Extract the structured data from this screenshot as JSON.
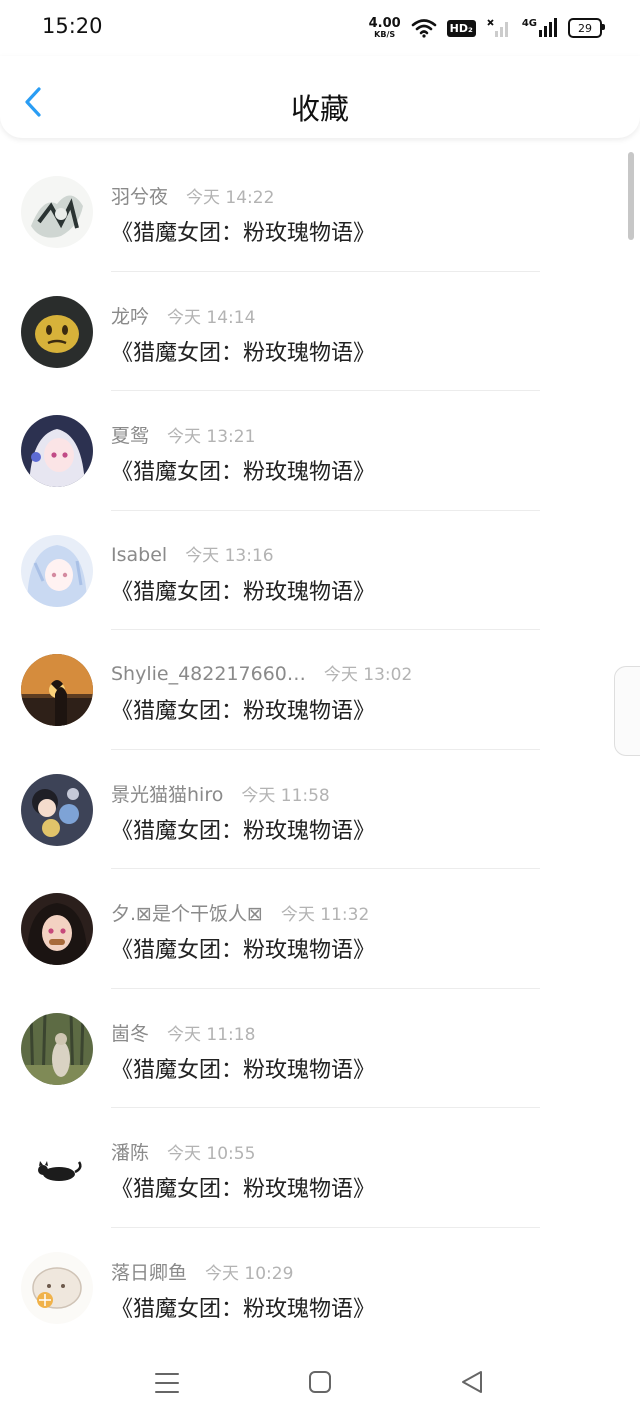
{
  "status_bar": {
    "time": "15:20",
    "net_speed_value": "4.00",
    "net_speed_unit": "KB/S",
    "hd_label": "HD₂",
    "network_type": "4G",
    "battery": "29"
  },
  "header": {
    "title": "收藏",
    "back_icon": "chevron-left-icon",
    "accent_color": "#2a9df4"
  },
  "items": [
    {
      "user": "羽兮夜",
      "time": "今天 14:22",
      "message": "《猎魔女团：粉玫瑰物语》"
    },
    {
      "user": "龙吟",
      "time": "今天 14:14",
      "message": "《猎魔女团：粉玫瑰物语》"
    },
    {
      "user": "夏鸳",
      "time": "今天 13:21",
      "message": "《猎魔女团：粉玫瑰物语》"
    },
    {
      "user": "Isabel",
      "time": "今天 13:16",
      "message": "《猎魔女团：粉玫瑰物语》"
    },
    {
      "user": "Shylie_482217660…",
      "time": "今天 13:02",
      "message": "《猎魔女团：粉玫瑰物语》"
    },
    {
      "user": "景光猫猫hiro",
      "time": "今天 11:58",
      "message": "《猎魔女团：粉玫瑰物语》"
    },
    {
      "user": "夕.⊠是个干饭人⊠",
      "time": "今天 11:32",
      "message": "《猎魔女团：粉玫瑰物语》"
    },
    {
      "user": "崮冬",
      "time": "今天 11:18",
      "message": "《猎魔女团：粉玫瑰物语》"
    },
    {
      "user": "潘陈",
      "time": "今天 10:55",
      "message": "《猎魔女团：粉玫瑰物语》"
    },
    {
      "user": "落日卿鱼",
      "time": "今天 10:29",
      "message": "《猎魔女团：粉玫瑰物语》"
    }
  ],
  "nav_bar": {
    "menu_icon": "menu-icon",
    "home_icon": "home-square-icon",
    "back_icon": "back-triangle-icon"
  }
}
